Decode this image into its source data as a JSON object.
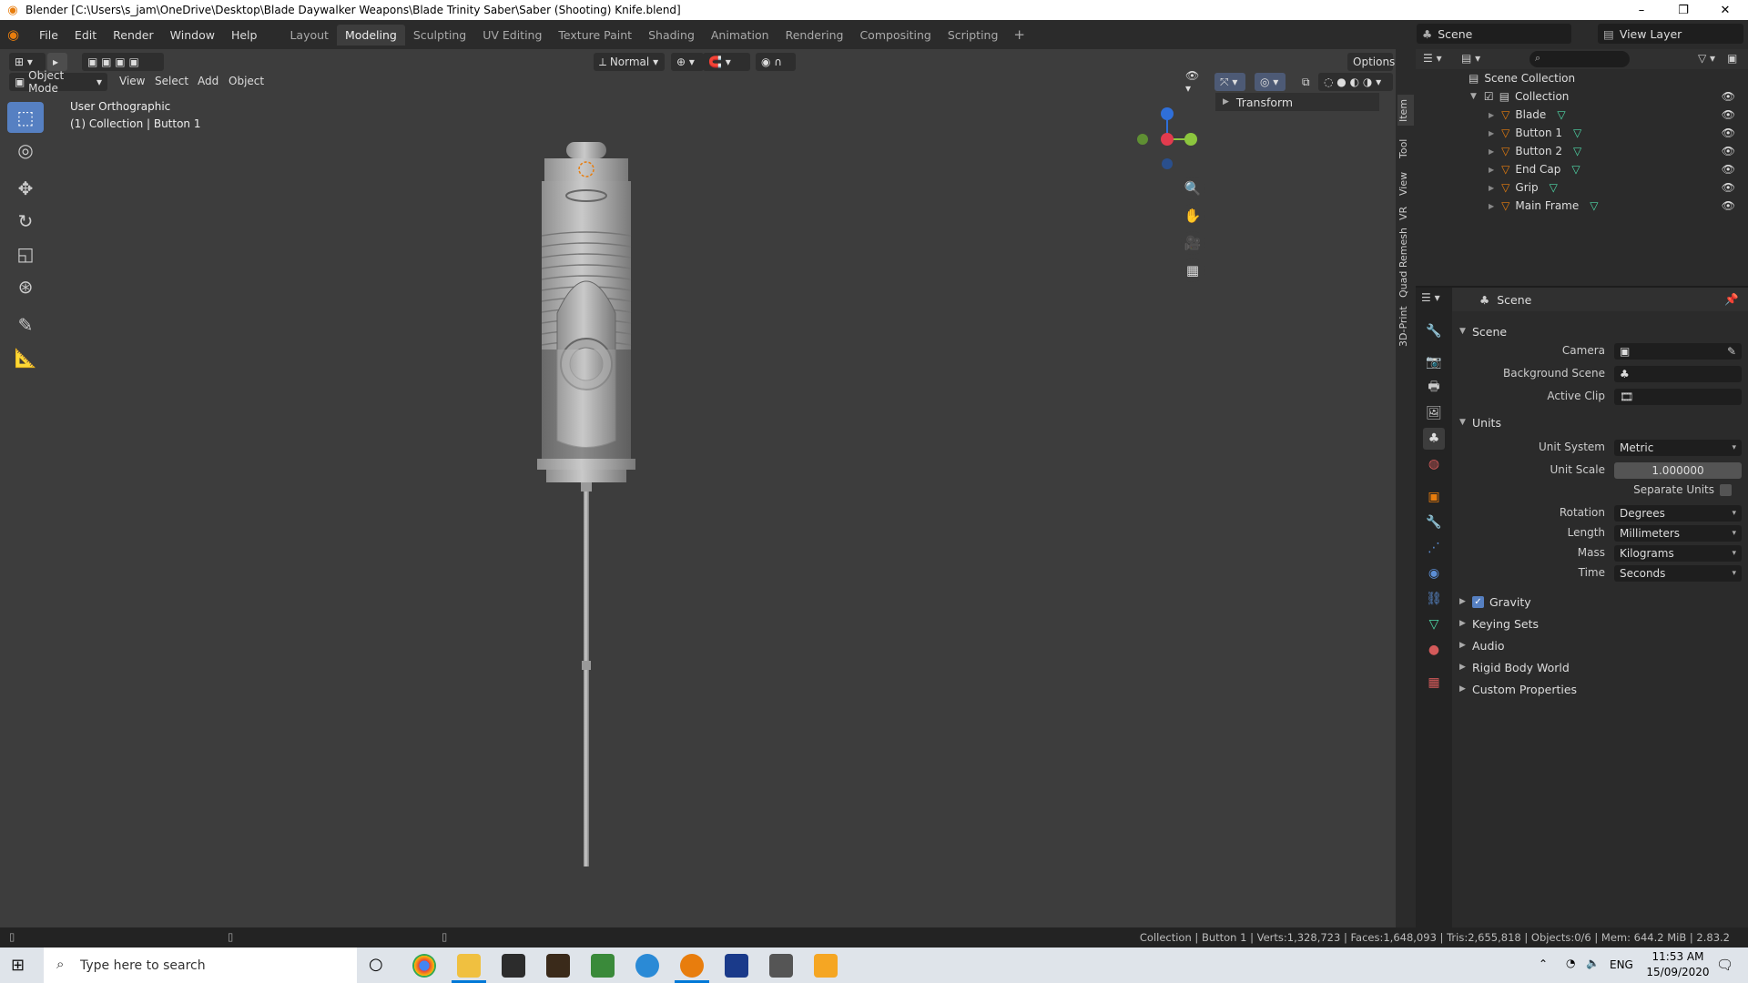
{
  "window": {
    "title": "Blender [C:\\Users\\s_jam\\OneDrive\\Desktop\\Blade Daywalker Weapons\\Blade Trinity Saber\\Saber (Shooting) Knife.blend]"
  },
  "menu": [
    "File",
    "Edit",
    "Render",
    "Window",
    "Help"
  ],
  "workspaces": [
    "Layout",
    "Modeling",
    "Sculpting",
    "UV Editing",
    "Texture Paint",
    "Shading",
    "Animation",
    "Rendering",
    "Compositing",
    "Scripting"
  ],
  "active_workspace": "Modeling",
  "scene_name": "Scene",
  "view_layer": "View Layer",
  "viewport": {
    "mode": "Object Mode",
    "menus": [
      "View",
      "Select",
      "Add",
      "Object"
    ],
    "orientation": "Normal",
    "options": "Options",
    "view_name": "User Orthographic",
    "context": "(1) Collection | Button 1",
    "transform_panel": "Transform",
    "side_tabs": [
      "Item",
      "Tool",
      "View",
      "VR",
      "Quad Remesh",
      "3D-Print"
    ]
  },
  "outliner": {
    "root": "Scene Collection",
    "collection": "Collection",
    "objects": [
      "Blade",
      "Button 1",
      "Button 2",
      "End Cap",
      "Grip",
      "Main Frame"
    ]
  },
  "properties": {
    "header": "Scene",
    "scene_panel": "Scene",
    "camera_label": "Camera",
    "bg_scene_label": "Background Scene",
    "active_clip_label": "Active Clip",
    "units_panel": "Units",
    "unit_system_label": "Unit System",
    "unit_system": "Metric",
    "unit_scale_label": "Unit Scale",
    "unit_scale": "1.000000",
    "separate_units_label": "Separate Units",
    "rotation_label": "Rotation",
    "rotation": "Degrees",
    "length_label": "Length",
    "length": "Millimeters",
    "mass_label": "Mass",
    "mass": "Kilograms",
    "time_label": "Time",
    "time": "Seconds",
    "collapsed_panels": [
      "Gravity",
      "Keying Sets",
      "Audio",
      "Rigid Body World",
      "Custom Properties"
    ]
  },
  "status": "Collection | Button 1 | Verts:1,328,723 | Faces:1,648,093 | Tris:2,655,818 | Objects:0/6 | Mem: 644.2 MiB | 2.83.2",
  "taskbar": {
    "search_placeholder": "Type here to search",
    "lang": "ENG",
    "time": "11:53 AM",
    "date": "15/09/2020"
  },
  "colors": {
    "accent": "#5680c2",
    "blender_orange": "#e87d0d",
    "mesh_green": "#4fd9a8"
  }
}
